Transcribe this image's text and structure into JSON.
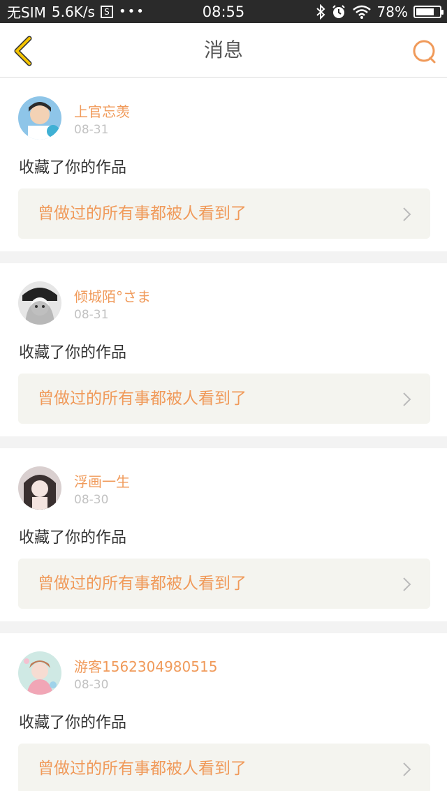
{
  "status_bar": {
    "carrier": "无SIM",
    "speed": "5.6K/s",
    "sim_icon_label": "S",
    "dots": "•••",
    "time": "08:55",
    "battery": "78%",
    "battery_level": 0.78
  },
  "header": {
    "title": "消息",
    "back_icon": "back-chevron-icon",
    "search_icon": "search-icon"
  },
  "messages": [
    {
      "user": "上官忘羡",
      "date": "08-31",
      "action": "收藏了你的作品",
      "work_title": "曾做过的所有事都被人看到了"
    },
    {
      "user": "倾城陌°さま",
      "date": "08-31",
      "action": "收藏了你的作品",
      "work_title": "曾做过的所有事都被人看到了"
    },
    {
      "user": "浮画一生",
      "date": "08-30",
      "action": "收藏了你的作品",
      "work_title": "曾做过的所有事都被人看到了"
    },
    {
      "user": "游客1562304980515",
      "date": "08-30",
      "action": "收藏了你的作品",
      "work_title": "曾做过的所有事都被人看到了"
    }
  ],
  "colors": {
    "accent": "#f09a5a",
    "back_icon": "#f5c400",
    "status_bar_bg": "#2a2a2a"
  }
}
